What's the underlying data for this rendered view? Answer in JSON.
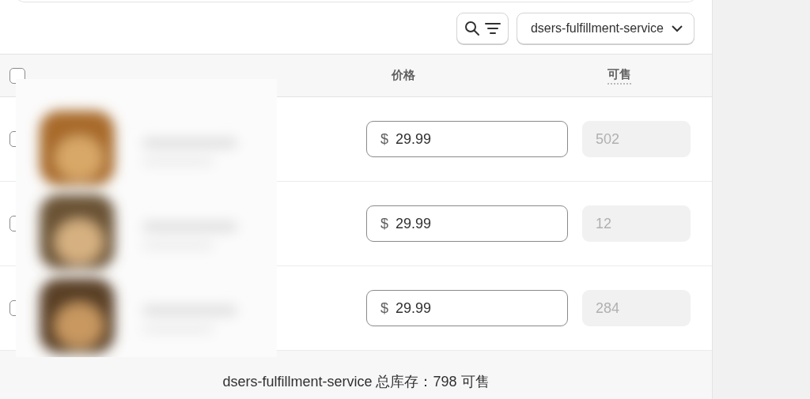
{
  "toolbar": {
    "location": "dsers-fulfillment-service"
  },
  "table": {
    "header_checked": false,
    "columns": [
      {
        "label": "价格"
      },
      {
        "label": "可售"
      }
    ],
    "rows": [
      {
        "checked": false,
        "currency": "$",
        "price": "29.99",
        "available": "502"
      },
      {
        "checked": false,
        "currency": "$",
        "price": "29.99",
        "available": "12"
      },
      {
        "checked": false,
        "currency": "$",
        "price": "29.99",
        "available": "284"
      }
    ]
  },
  "footer": "dsers-fulfillment-service 总库存：798 可售"
}
